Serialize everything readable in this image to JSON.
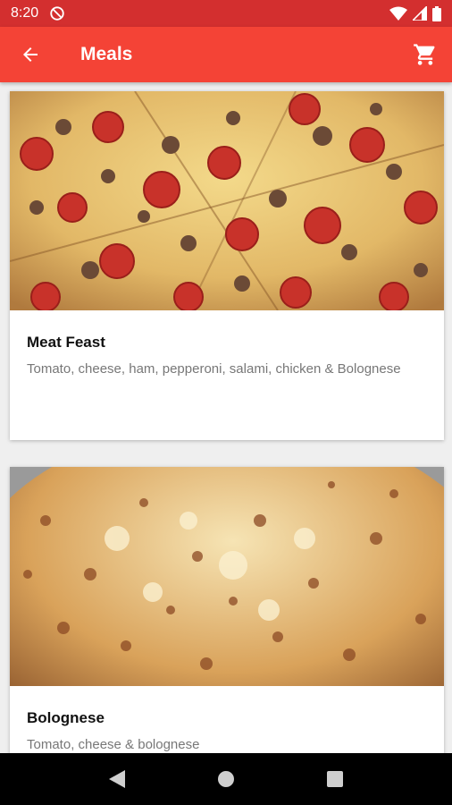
{
  "status_bar": {
    "time": "8:20"
  },
  "app_bar": {
    "title": "Meals",
    "colors": {
      "background": "#f44336",
      "status": "#d32f2f"
    }
  },
  "meals": [
    {
      "title": "Meat Feast",
      "description": "Tomato, cheese, ham, pepperoni, salami, chicken & Bolognese",
      "image": "pepperoni-pizza-image"
    },
    {
      "title": "Bolognese",
      "description": "Tomato, cheese & bolognese",
      "image": "bolognese-pizza-image"
    }
  ],
  "icons": {
    "back": "arrow-left-icon",
    "cart": "shopping-cart-icon",
    "nav_back": "triangle-back-icon",
    "nav_home": "circle-home-icon",
    "nav_recents": "square-recents-icon"
  }
}
